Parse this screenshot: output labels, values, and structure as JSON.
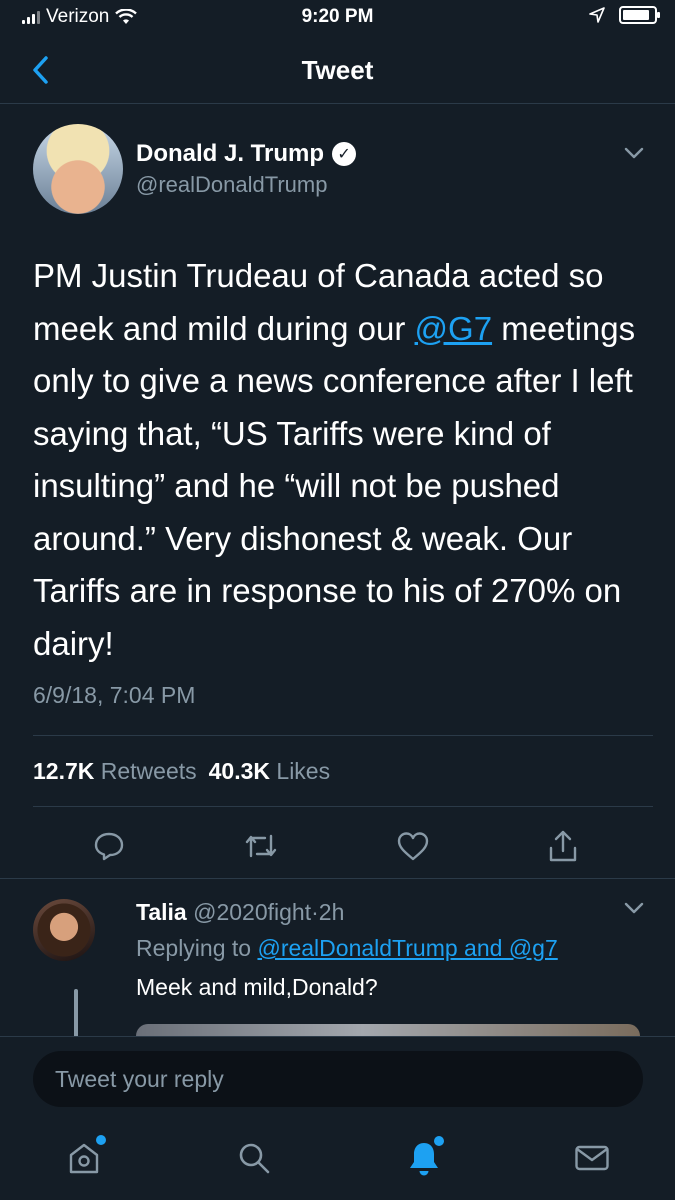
{
  "status_bar": {
    "carrier": "Verizon",
    "time": "9:20 PM"
  },
  "nav": {
    "title": "Tweet"
  },
  "tweet": {
    "display_name": "Donald J. Trump",
    "handle": "@realDonaldTrump",
    "text_before": "PM Justin Trudeau of Canada acted so meek and mild during our ",
    "mention": "@G7",
    "text_after": " meetings only to give a news conference after I left saying that, “US Tariffs were kind of insulting” and he “will not be pushed around.” Very dishonest & weak. Our Tariffs are in response to his of 270% on dairy!",
    "timestamp": "6/9/18, 7:04 PM",
    "retweets_count": "12.7K",
    "retweets_label": "Retweets",
    "likes_count": "40.3K",
    "likes_label": "Likes"
  },
  "reply": {
    "name": "Talia",
    "handle": "@2020fight",
    "separator": "·",
    "time": "2h",
    "replying_prefix": "Replying to",
    "replying_to": "@realDonaldTrump and @g7",
    "text": "Meek and mild,Donald?"
  },
  "compose": {
    "placeholder": "Tweet your reply"
  },
  "icons": {
    "back": "chevron-left-icon",
    "caret": "chevron-down-icon",
    "verified": "verified-badge-icon",
    "reply": "reply-icon",
    "retweet": "retweet-icon",
    "like": "heart-icon",
    "share": "share-icon",
    "home": "home-icon",
    "search": "search-icon",
    "notifications": "bell-icon",
    "messages": "mail-icon"
  },
  "colors": {
    "background": "#141d26",
    "accent": "#1da1f2",
    "muted": "#8899a6",
    "border": "#2b3a48"
  }
}
